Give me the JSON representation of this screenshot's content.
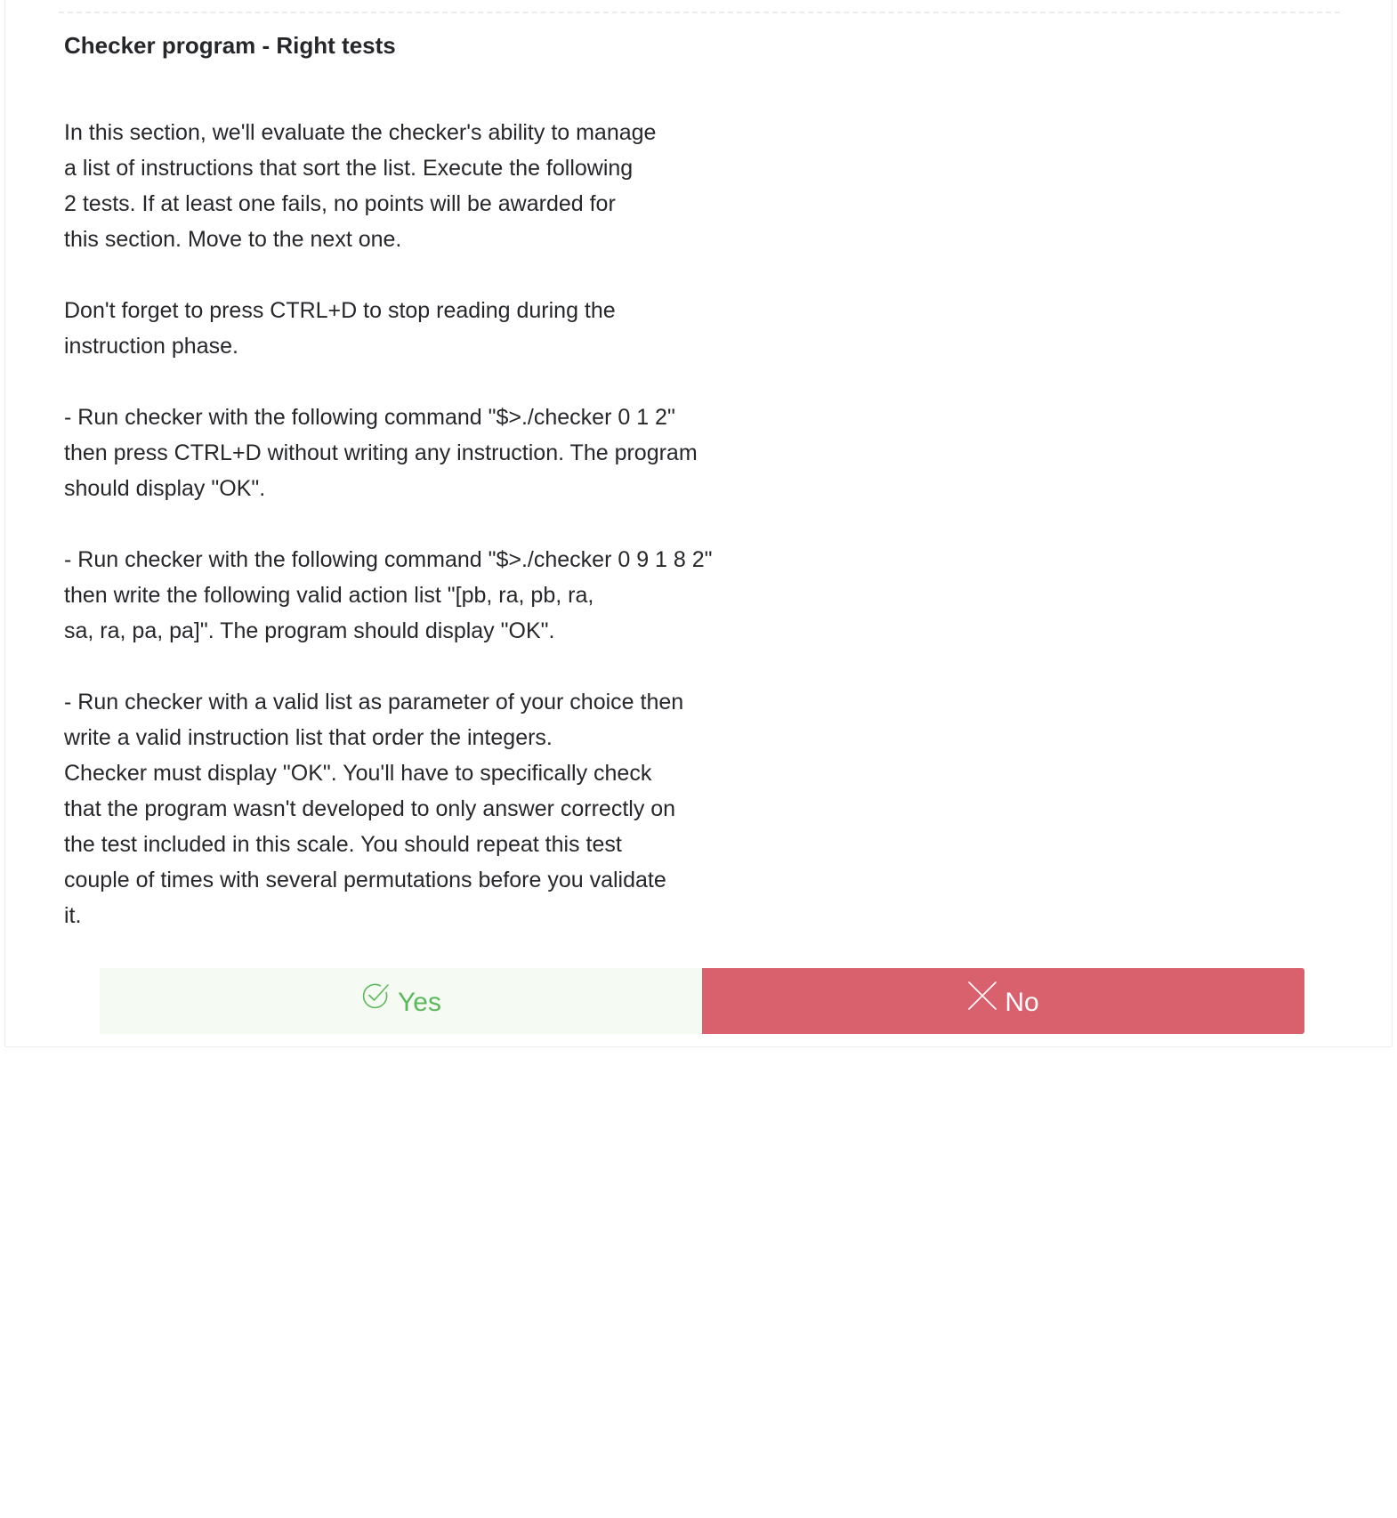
{
  "section": {
    "title": "Checker program - Right tests",
    "paragraphs": [
      {
        "lines": [
          "In this section, we'll evaluate the checker's ability to manage",
          "a list of instructions that sort the list. Execute the following",
          "2 tests. If at least one fails, no points will be awarded for",
          "this section. Move to the next one."
        ]
      },
      {
        "lines": [
          "Don't forget to press CTRL+D to stop reading during the",
          "instruction phase."
        ]
      },
      {
        "lines": [
          "- Run checker with the following command \"$>./checker 0 1 2\"",
          "then press CTRL+D without writing any instruction. The program",
          "should display \"OK\"."
        ]
      },
      {
        "lines": [
          "- Run checker with the following command \"$>./checker 0 9 1 8 2\"",
          "then write the following valid action list \"[pb, ra, pb, ra,",
          "sa, ra, pa, pa]\". The program should display \"OK\"."
        ]
      },
      {
        "lines": [
          "- Run checker with a valid list as parameter of your choice then",
          "write a valid instruction list that order the integers.",
          "Checker must display \"OK\". You'll have to specifically check",
          "that the program wasn't developed to only answer correctly on",
          "the test included in this scale. You should repeat this test",
          "couple of times with several permutations before you validate",
          "it."
        ]
      }
    ]
  },
  "answers": {
    "yes": {
      "label": "Yes",
      "icon": "check-circle-icon",
      "color": "#5cb85c",
      "background": "#f5faf3"
    },
    "no": {
      "label": "No",
      "icon": "close-icon",
      "color": "#ffffff",
      "background": "#d9606d"
    }
  }
}
